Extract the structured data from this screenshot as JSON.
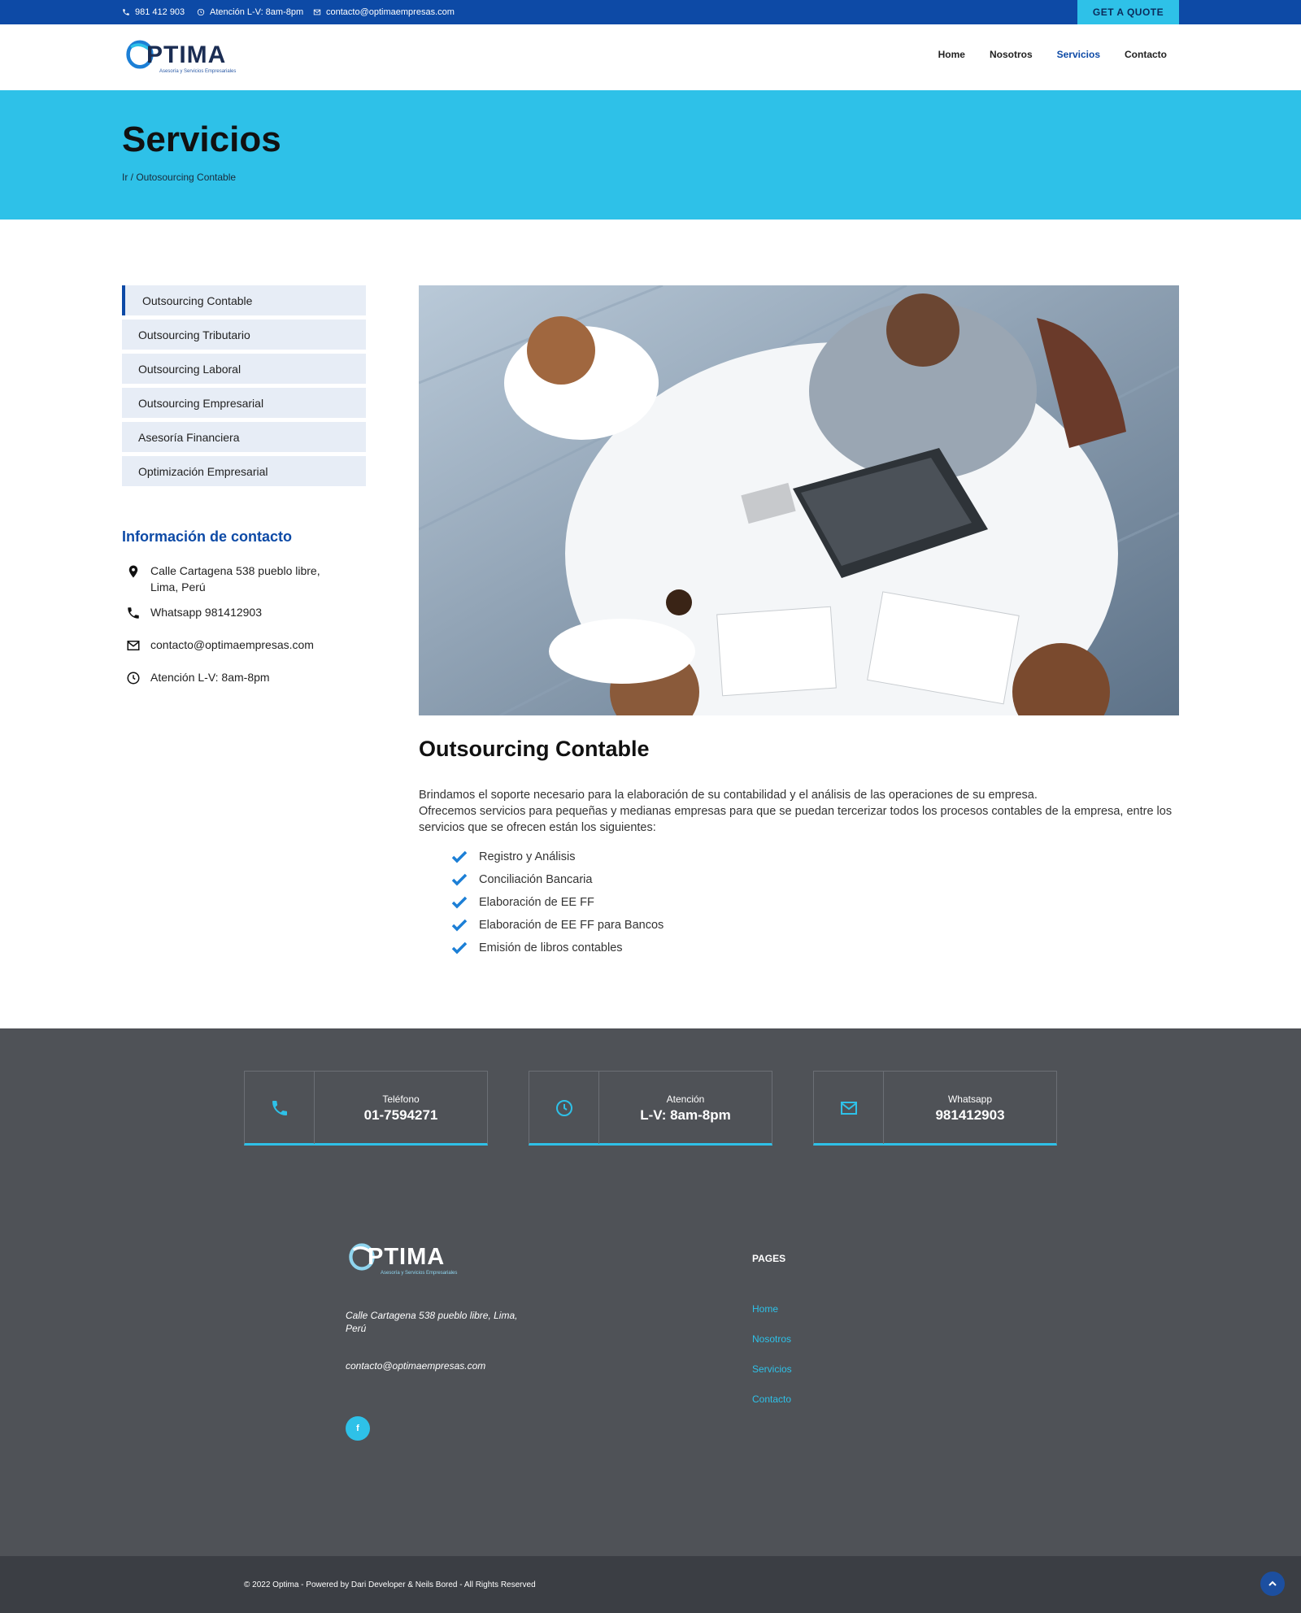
{
  "topbar": {
    "phone": "981 412 903",
    "hours": "Atención L-V: 8am-8pm",
    "email": "contacto@optimaempresas.com",
    "quote_label": "GET A QUOTE"
  },
  "brand": {
    "name": "PTIMA",
    "tagline": "Asesoría y Servicios Empresariales"
  },
  "nav": {
    "items": [
      {
        "label": "Home"
      },
      {
        "label": "Nosotros"
      },
      {
        "label": "Servicios"
      },
      {
        "label": "Contacto"
      }
    ],
    "active": "Servicios"
  },
  "banner": {
    "title": "Servicios",
    "breadcrumb": "Ir / Outosourcing Contable"
  },
  "sidebar": {
    "items": [
      {
        "label": "Outsourcing Contable"
      },
      {
        "label": "Outsourcing Tributario"
      },
      {
        "label": "Outsourcing Laboral"
      },
      {
        "label": "Outsourcing Empresarial"
      },
      {
        "label": "Asesoría Financiera"
      },
      {
        "label": "Optimización Empresarial"
      }
    ],
    "contact_title": "Información de contacto",
    "contact": {
      "address": "Calle Cartagena 538 pueblo libre, Lima, Perú",
      "whatsapp": "Whatsapp 981412903",
      "email": "contacto@optimaempresas.com",
      "hours": "Atención L-V: 8am-8pm"
    }
  },
  "main": {
    "title": "Outsourcing Contable",
    "para1": "Brindamos el soporte necesario para la elaboración de su contabilidad y el análisis de las operaciones de su empresa.",
    "para2": "Ofrecemos servicios para pequeñas y medianas empresas para que se puedan tercerizar todos los procesos contables de la empresa, entre los servicios que se ofrecen están los siguientes:",
    "services": [
      "Registro y Análisis",
      "Conciliación Bancaria",
      "Elaboración de EE FF",
      "Elaboración de EE FF para Bancos",
      "Emisión de libros contables"
    ]
  },
  "footer": {
    "boxes": [
      {
        "label": "Teléfono",
        "value": "01-7594271",
        "icon": "phone-icon"
      },
      {
        "label": "Atención",
        "value": "L-V: 8am-8pm",
        "icon": "clock-icon"
      },
      {
        "label": "Whatsapp",
        "value": "981412903",
        "icon": "mail-icon"
      }
    ],
    "address": "Calle Cartagena 538 pueblo libre, Lima, Perú",
    "email": "contacto@optimaempresas.com",
    "social_label": "f",
    "pages_title": "PAGES",
    "pages": [
      {
        "label": "Home"
      },
      {
        "label": "Nosotros"
      },
      {
        "label": "Servicios"
      },
      {
        "label": "Contacto"
      }
    ],
    "copyright": "© 2022 Optima - Powered by Dari Developer & Neils Bored - All Rights Reserved"
  },
  "colors": {
    "primary": "#0d4aa6",
    "accent": "#2ec1e8",
    "footer_bg": "#4f5257",
    "bottom_bg": "#3b3e44"
  }
}
